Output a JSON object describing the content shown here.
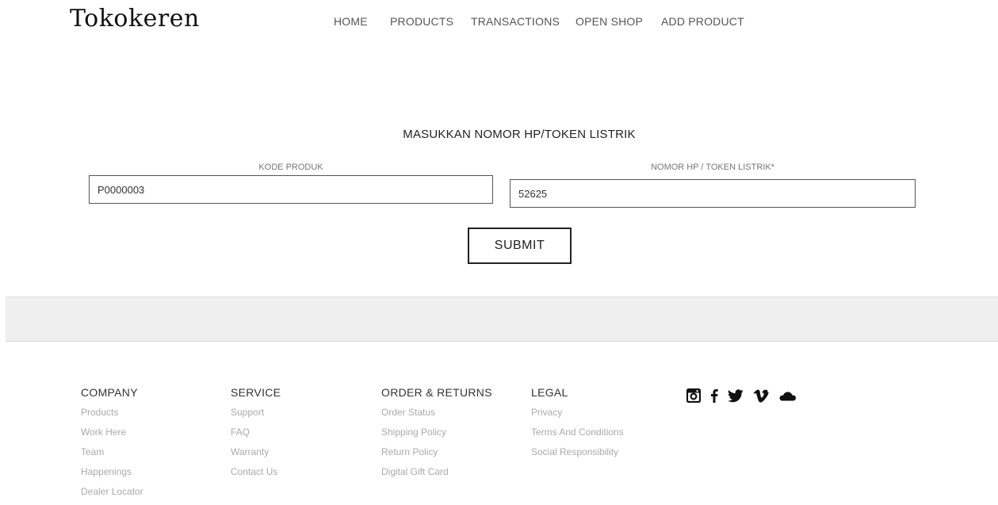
{
  "header": {
    "logo": "Tokokeren",
    "nav": [
      "HOME",
      "PRODUCTS",
      "TRANSACTIONS",
      "OPEN SHOP",
      "ADD PRODUCT"
    ]
  },
  "form": {
    "title": "MASUKKAN NOMOR HP/TOKEN LISTRIK",
    "kode_label": "KODE PRODUK",
    "kode_value": "P0000003",
    "nomor_label": "NOMOR HP / TOKEN LISTRIK*",
    "nomor_value": "52625",
    "submit_label": "SUBMIT"
  },
  "footer": {
    "columns": [
      {
        "heading": "COMPANY",
        "links": [
          "Products",
          "Work Here",
          "Team",
          "Happenings",
          "Dealer Locator"
        ]
      },
      {
        "heading": "SERVICE",
        "links": [
          "Support",
          "FAQ",
          "Warranty",
          "Contact Us"
        ]
      },
      {
        "heading": "ORDER & RETURNS",
        "links": [
          "Order Status",
          "Shipping Policy",
          "Return Policy",
          "Digital Gift Card"
        ]
      },
      {
        "heading": "LEGAL",
        "links": [
          "Privacy",
          "Terms And Conditions",
          "Social Responsibility"
        ]
      }
    ],
    "social_icons": [
      "instagram-icon",
      "facebook-icon",
      "twitter-icon",
      "vimeo-icon",
      "soundcloud-icon"
    ]
  }
}
